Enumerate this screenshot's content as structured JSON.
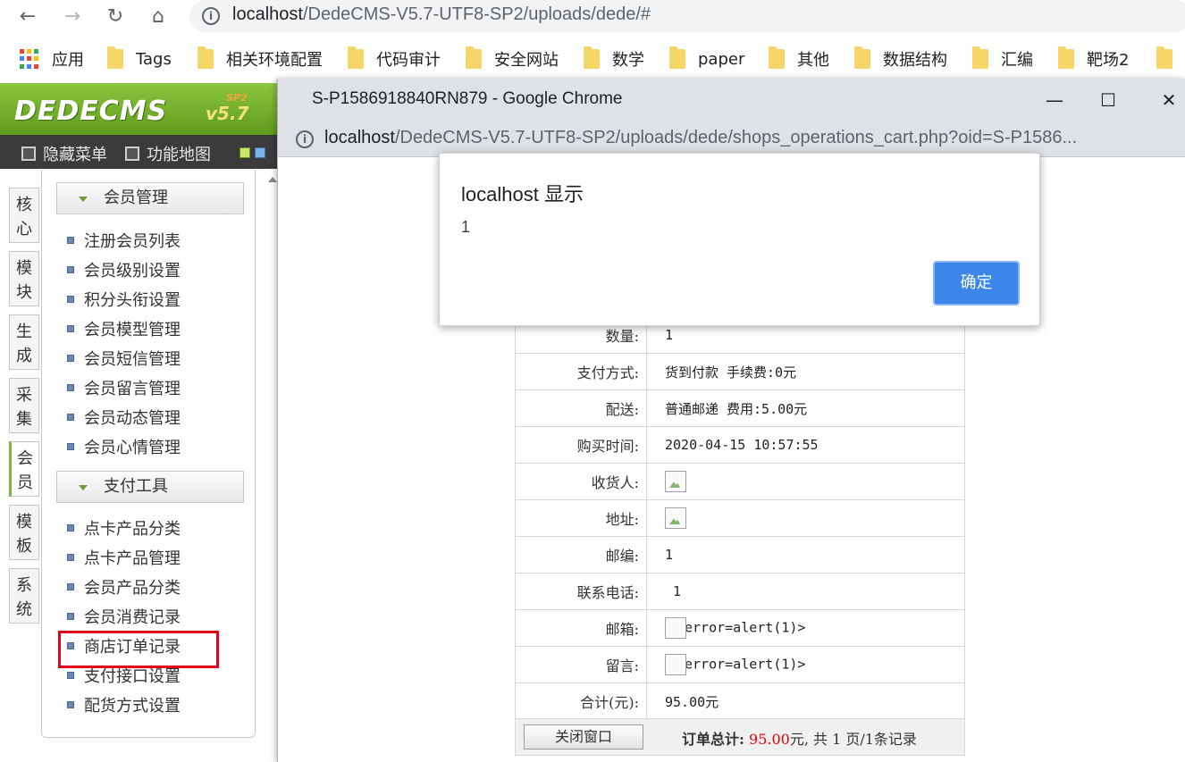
{
  "browser": {
    "url_host": "localhost",
    "url_path": "/DedeCMS-V5.7-UTF8-SP2/uploads/dede/#",
    "bookmarks": [
      {
        "label": "应用",
        "type": "apps"
      },
      {
        "label": "Tags",
        "type": "folder"
      },
      {
        "label": "相关环境配置",
        "type": "folder"
      },
      {
        "label": "代码审计",
        "type": "folder"
      },
      {
        "label": "安全网站",
        "type": "folder"
      },
      {
        "label": "数学",
        "type": "folder"
      },
      {
        "label": "paper",
        "type": "folder"
      },
      {
        "label": "其他",
        "type": "folder"
      },
      {
        "label": "数据结构",
        "type": "folder"
      },
      {
        "label": "汇编",
        "type": "folder"
      },
      {
        "label": "靶场2",
        "type": "folder"
      }
    ]
  },
  "dede": {
    "logo": "DEDECMS",
    "version": "v5.7",
    "sp": "SP2",
    "toolbar": {
      "hide_menu": "隐藏菜单",
      "func_map": "功能地图"
    },
    "side_tabs": [
      "核心",
      "模块",
      "生成",
      "采集",
      "会员",
      "模板",
      "系统"
    ],
    "active_tab": "会员",
    "member_section": {
      "title": "会员管理",
      "items": [
        "注册会员列表",
        "会员级别设置",
        "积分头衔设置",
        "会员模型管理",
        "会员短信管理",
        "会员留言管理",
        "会员动态管理",
        "会员心情管理"
      ]
    },
    "pay_section": {
      "title": "支付工具",
      "items": [
        "点卡产品分类",
        "点卡产品管理",
        "会员产品分类",
        "会员消费记录",
        "商店订单记录",
        "支付接口设置",
        "配货方式设置"
      ]
    },
    "highlighted_item": "商店订单记录"
  },
  "popup": {
    "title": "S-P1586918840RN879 - Google Chrome",
    "url_host": "localhost",
    "url_path": "/DedeCMS-V5.7-UTF8-SP2/uploads/dede/shops_operations_cart.php?oid=S-P1586...",
    "rows": [
      {
        "label": "数量:",
        "value": "1"
      },
      {
        "label": "支付方式:",
        "value": "货到付款 手续费:0元"
      },
      {
        "label": "配送:",
        "value": "普通邮递 费用:5.00元"
      },
      {
        "label": "购买时间:",
        "value": "2020-04-15 10:57:55"
      },
      {
        "label": "收货人:",
        "value": "",
        "broken_image": true
      },
      {
        "label": "地址:",
        "value": "",
        "broken_image": true
      },
      {
        "label": "邮编:",
        "value": "1"
      },
      {
        "label": "联系电话:",
        "value": " 1"
      },
      {
        "label": "邮箱:",
        "value": "error=alert(1)>",
        "broken_inline": true
      },
      {
        "label": "留言:",
        "value": "error=alert(1)>",
        "broken_inline": true
      },
      {
        "label": "合计(元):",
        "value": "95.00元"
      }
    ],
    "close_button": "关闭窗口",
    "total_label": "订单总计:",
    "total_amount": "95.00",
    "total_suffix": "元, 共 1 页/1条记录"
  },
  "alert": {
    "title": "localhost 显示",
    "message": "1",
    "ok_label": "确定"
  }
}
